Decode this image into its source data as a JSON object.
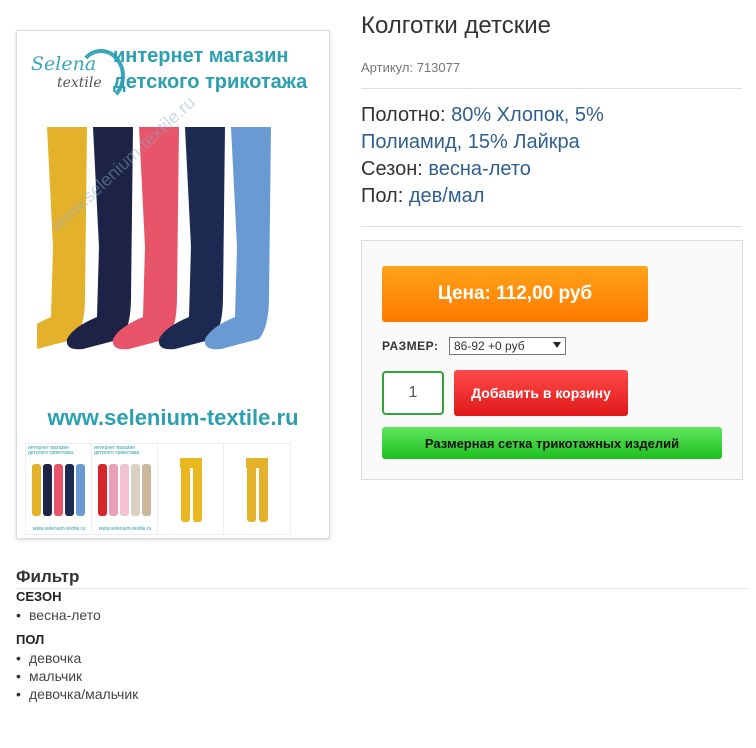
{
  "product": {
    "title": "Колготки детские",
    "sku_label": "Артикул:",
    "sku": "713077",
    "properties": [
      {
        "label": "Полотно:",
        "value": "80% Хлопок, 5%"
      },
      {
        "label": "",
        "value": "Полиамид, 15% Лайкра"
      },
      {
        "label": "Сезон:",
        "value": "весна-лето"
      },
      {
        "label": "Пол:",
        "value": "дев/мал"
      }
    ]
  },
  "image": {
    "logo_line1": "Selena",
    "logo_line2": "textile",
    "shop_title": "интернет магазин детского трикотажа",
    "watermark": "www.selenium-textile.ru",
    "site_url": "www.selenium-textile.ru",
    "tights_colors": [
      "#e3b22a",
      "#1d2346",
      "#e8546a",
      "#1c2a52",
      "#6a9ad4"
    ],
    "thumbnails": [
      {
        "caption": "интернет магазин детского трикотажа",
        "footer": "www.selenium-textile.ru",
        "colors": [
          "#e3b22a",
          "#1d2346",
          "#e8546a",
          "#1c2a52",
          "#6a9ad4"
        ]
      },
      {
        "caption": "интернет магазин детского трикотажа",
        "footer": "www.selenium-textile.ru",
        "colors": [
          "#d6262c",
          "#e9a0b8",
          "#f2c2d0",
          "#d8d0c0",
          "#c9b89a"
        ]
      },
      {
        "caption": "",
        "footer": "",
        "colors": [
          "#e9b820"
        ]
      },
      {
        "caption": "",
        "footer": "",
        "colors": [
          "#e3b22a"
        ]
      }
    ]
  },
  "buy": {
    "price_label": "Цена: 112,00 руб",
    "size_label": "РАЗМЕР:",
    "size_selected": "86-92 +0 руб",
    "quantity": "1",
    "add_to_cart": "Добавить в корзину",
    "size_chart": "Размерная сетка трикотажных изделий"
  },
  "filter": {
    "title": "Фильтр",
    "groups": [
      {
        "title": "СЕЗОН",
        "items": [
          "весна-лето"
        ]
      },
      {
        "title": "ПОЛ",
        "items": [
          "девочка",
          "мальчик",
          "девочка/мальчик"
        ]
      }
    ]
  }
}
